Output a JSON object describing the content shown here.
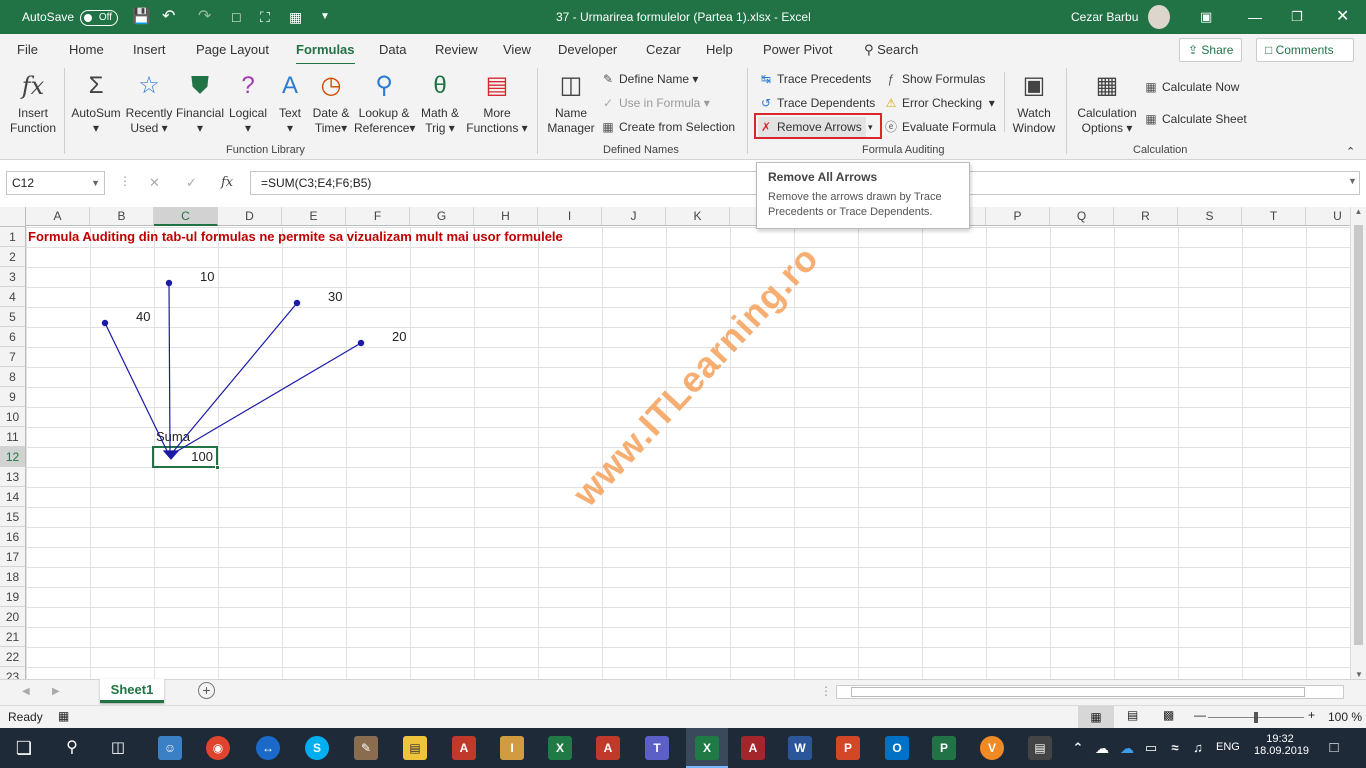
{
  "title_bar": {
    "autosave_label": "AutoSave",
    "autosave_state": "Off",
    "document_title": "37 - Urmarirea formulelor (Partea 1).xlsx  -  Excel",
    "user_name": "Cezar Barbu"
  },
  "ribbon_tabs": [
    "File",
    "Home",
    "Insert",
    "Page Layout",
    "Formulas",
    "Data",
    "Review",
    "View",
    "Developer",
    "Cezar",
    "Help",
    "Power Pivot"
  ],
  "active_tab": "Formulas",
  "search_label": "Search",
  "share_label": "Share",
  "comments_label": "Comments",
  "function_library": {
    "label": "Function Library",
    "insert_function": [
      "Insert",
      "Function"
    ],
    "autosum": "AutoSum",
    "recently_used": [
      "Recently",
      "Used"
    ],
    "financial": "Financial",
    "logical": "Logical",
    "text": "Text",
    "date_time": [
      "Date &",
      "Time"
    ],
    "lookup": [
      "Lookup &",
      "Reference"
    ],
    "math": [
      "Math &",
      "Trig"
    ],
    "more": [
      "More",
      "Functions"
    ]
  },
  "defined_names": {
    "label": "Defined Names",
    "name_manager": [
      "Name",
      "Manager"
    ],
    "define_name": "Define Name",
    "use_in_formula": "Use in Formula",
    "create_from_selection": "Create from Selection"
  },
  "formula_auditing": {
    "label": "Formula Auditing",
    "trace_precedents": "Trace Precedents",
    "trace_dependents": "Trace Dependents",
    "remove_arrows": "Remove Arrows",
    "show_formulas": "Show Formulas",
    "error_checking": "Error Checking",
    "evaluate_formula": "Evaluate Formula",
    "watch_window": [
      "Watch",
      "Window"
    ]
  },
  "calculation": {
    "label": "Calculation",
    "calc_options": [
      "Calculation",
      "Options"
    ],
    "calc_now": "Calculate Now",
    "calc_sheet": "Calculate Sheet"
  },
  "tooltip": {
    "title": "Remove All Arrows",
    "body": "Remove the arrows drawn by Trace Precedents or Trace Dependents."
  },
  "formula_bar": {
    "name_box": "C12",
    "fx": "fx",
    "formula": "=SUM(C3;E4;F6;B5)"
  },
  "columns": [
    "A",
    "B",
    "C",
    "D",
    "E",
    "F",
    "G",
    "H",
    "I",
    "J",
    "K",
    "L",
    "M",
    "N",
    "O",
    "P",
    "Q",
    "R",
    "S",
    "T",
    "U"
  ],
  "rows": [
    "1",
    "2",
    "3",
    "4",
    "5",
    "6",
    "7",
    "8",
    "9",
    "10",
    "11",
    "12",
    "13",
    "14",
    "15",
    "16",
    "17",
    "18",
    "19",
    "20",
    "21",
    "22",
    "23"
  ],
  "cells": {
    "a1": "Formula Auditing din tab-ul formulas ne permite sa vizualizam mult mai usor formulele",
    "c3": "10",
    "e4": "30",
    "b5": "40",
    "f6": "20",
    "c11": "Suma",
    "c12": "100"
  },
  "watermark": "www.ITLearning.ro",
  "sheet_tab": "Sheet1",
  "status": {
    "ready": "Ready",
    "zoom": "100 %"
  },
  "taskbar": {
    "language": "ENG",
    "time": "19:32",
    "date": "18.09.2019"
  },
  "colors": {
    "excel_green": "#217346",
    "arrow_blue": "#1a1aa6",
    "heading_red": "#c00000",
    "highlight_red": "#d9272e",
    "watermark": "#f6a15a"
  }
}
